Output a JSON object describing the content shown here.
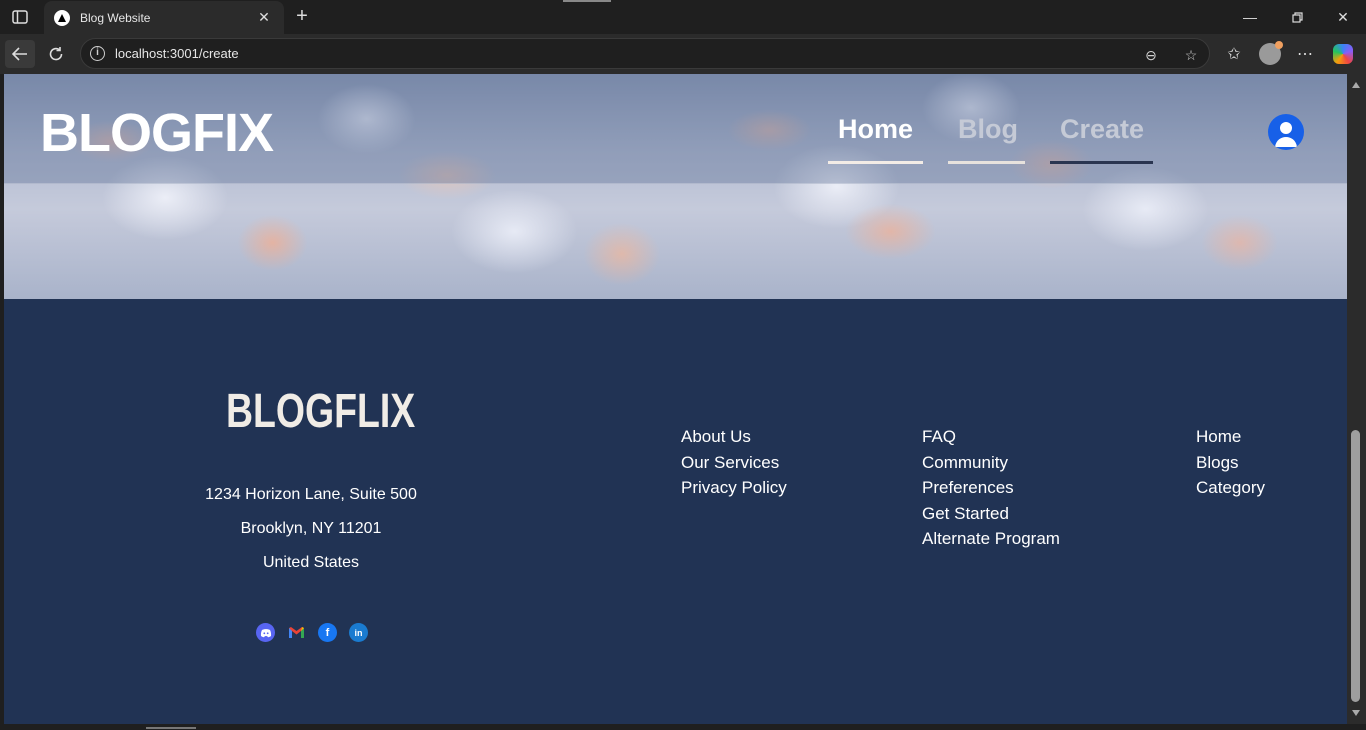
{
  "browser": {
    "tab_title": "Blog Website",
    "url": "localhost:3001/create"
  },
  "site": {
    "logo": "BLOGFIX",
    "nav": [
      {
        "label": "Home",
        "color": "#ffffff",
        "underline": "#f3ece6"
      },
      {
        "label": "Blog",
        "color": "#c5cad6",
        "underline": "#e7e2dd"
      },
      {
        "label": "Create",
        "color": "#c5cad6",
        "underline": "#2a3550"
      }
    ]
  },
  "footer": {
    "logo": "BLOGFLIX",
    "address": [
      "1234 Horizon Lane, Suite 500",
      "Brooklyn, NY 11201",
      "United States"
    ],
    "socials": [
      {
        "icon": "discord-icon",
        "glyph": "◉",
        "color": "#5865f2"
      },
      {
        "icon": "gmail-icon",
        "glyph": "M",
        "color": "transparent"
      },
      {
        "icon": "facebook-icon",
        "glyph": "f",
        "color": "#1877f2"
      },
      {
        "icon": "linkedin-icon",
        "glyph": "in",
        "color": "#1a7bd0"
      }
    ],
    "columns": [
      [
        "About Us",
        "Our Services",
        "Privacy Policy"
      ],
      [
        "FAQ",
        "Community",
        "Preferences",
        "Get Started",
        "Alternate Program"
      ],
      [
        "Home",
        "Blogs",
        "Category"
      ]
    ]
  }
}
